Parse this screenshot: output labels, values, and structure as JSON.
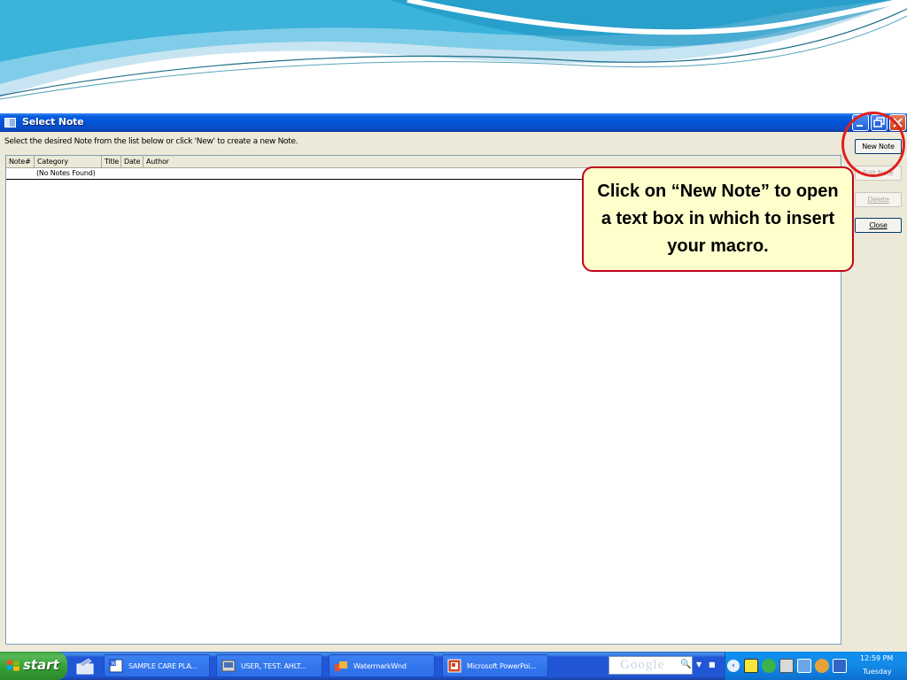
{
  "window": {
    "title": "Select Note",
    "instruction": "Select the desired Note from the list below or click 'New' to create a new Note."
  },
  "list": {
    "columns": [
      "Note#",
      "Category",
      "Title",
      "Date",
      "Author"
    ],
    "empty_message": "(No Notes Found)"
  },
  "buttons": {
    "new_note": "New Note",
    "edit_note": "Edit Note",
    "delete": "Delete",
    "close": "Close"
  },
  "callout": {
    "text": "Click on “New Note” to open a text box in which to insert your macro."
  },
  "taskbar": {
    "start_label": "start",
    "tasks": [
      "SAMPLE CARE PLA...",
      "USER, TEST: AHLT...",
      "WatermarkWnd",
      "Microsoft PowerPoi..."
    ],
    "search_placeholder": "Google",
    "clock_time": "12:59 PM",
    "clock_day": "Tuesday"
  },
  "colors": {
    "titlebar": "#0153d6",
    "callout_border": "#c0001a",
    "callout_fill": "#ffffcc",
    "highlight": "#e0201e",
    "start_green": "#37a337"
  }
}
